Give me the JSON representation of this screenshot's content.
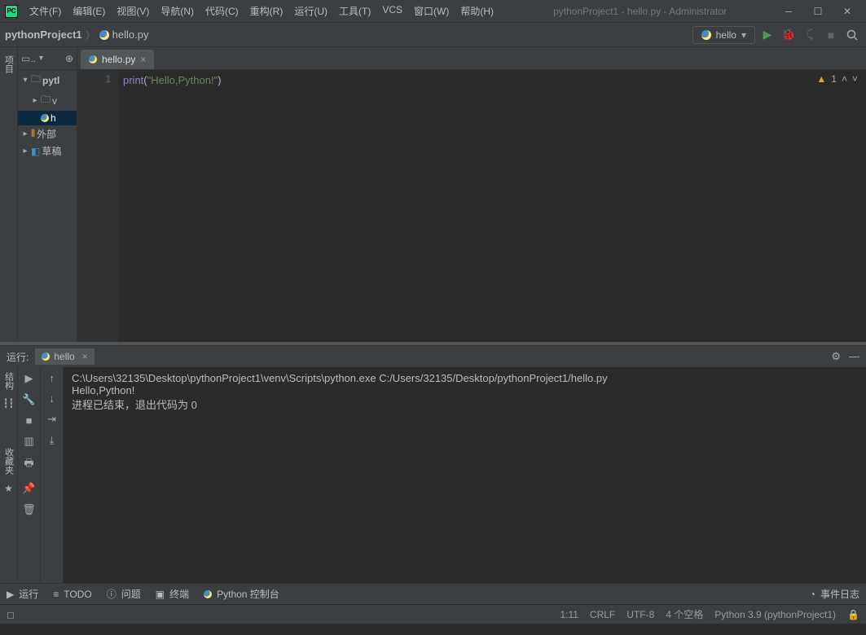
{
  "window": {
    "title": "pythonProject1 - hello.py - Administrator"
  },
  "app_icon": "PC",
  "menu": {
    "file": "文件(F)",
    "edit": "编辑(E)",
    "view": "视图(V)",
    "navigate": "导航(N)",
    "code": "代码(C)",
    "refactor": "重构(R)",
    "run": "运行(U)",
    "tools": "工具(T)",
    "vcs": "VCS",
    "window": "窗口(W)",
    "help": "帮助(H)"
  },
  "breadcrumb": {
    "project": "pythonProject1",
    "file": "hello.py"
  },
  "run_config": {
    "name": "hello"
  },
  "side_tabs": {
    "project": "项目"
  },
  "tree": {
    "root": "pytl",
    "venv": "v",
    "hello": "h",
    "external": "外部",
    "scratches": "草稿"
  },
  "editor": {
    "tab": "hello.py",
    "line_no": "1",
    "code_keyword": "print",
    "code_string": "\"Hello,Python!\"",
    "warnings": "1"
  },
  "console": {
    "label": "运行:",
    "tab": "hello",
    "line1": "C:\\Users\\32135\\Desktop\\pythonProject1\\venv\\Scripts\\python.exe C:/Users/32135/Desktop/pythonProject1/hello.py",
    "line2": "Hello,Python!",
    "line3": "",
    "line4": "进程已结束，退出代码为 0"
  },
  "left_tabs": {
    "structure": "结构",
    "favorites": "收藏夹"
  },
  "bottom_tabs": {
    "run": "运行",
    "todo": "TODO",
    "problems": "问题",
    "terminal": "终端",
    "python_console": "Python 控制台",
    "event_log": "事件日志"
  },
  "status": {
    "caret": "1:11",
    "line_sep": "CRLF",
    "encoding": "UTF-8",
    "indent": "4 个空格",
    "interpreter": "Python 3.9 (pythonProject1)"
  }
}
